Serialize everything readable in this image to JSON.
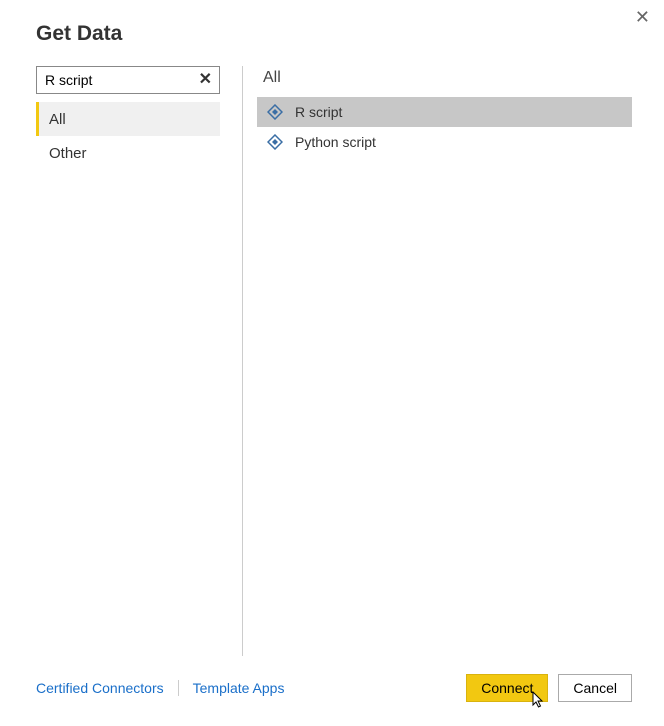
{
  "header": {
    "title": "Get Data"
  },
  "search": {
    "value": "R script"
  },
  "categories": [
    {
      "label": "All",
      "selected": true
    },
    {
      "label": "Other",
      "selected": false
    }
  ],
  "right_header": "All",
  "connectors": [
    {
      "label": "R script",
      "selected": true
    },
    {
      "label": "Python script",
      "selected": false
    }
  ],
  "footer": {
    "certified_link": "Certified Connectors",
    "template_link": "Template Apps",
    "connect_label": "Connect",
    "cancel_label": "Cancel"
  }
}
